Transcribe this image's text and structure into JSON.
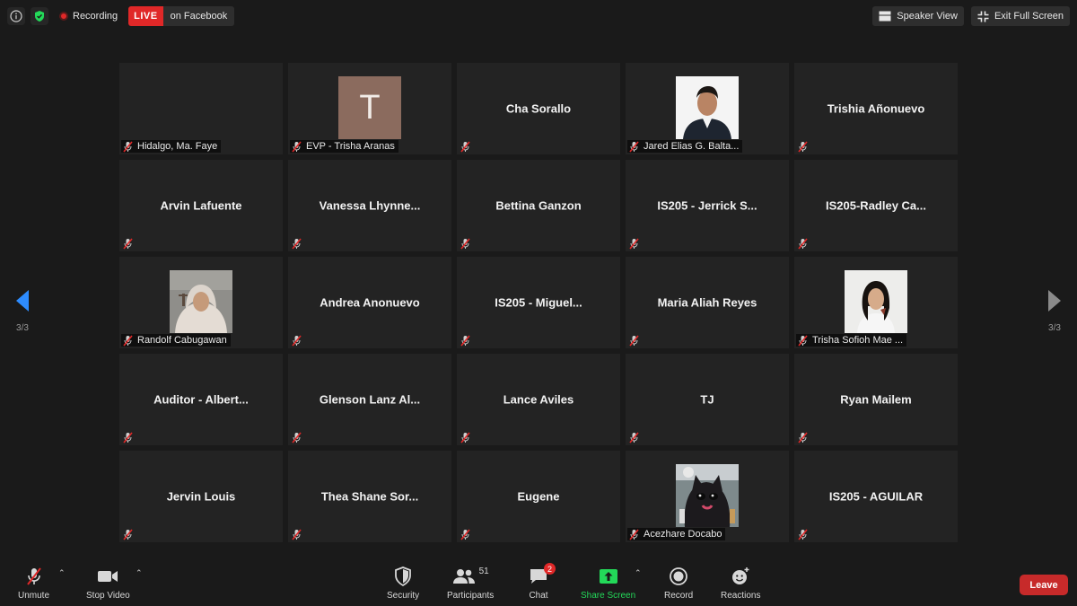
{
  "topbar": {
    "recording_label": "Recording",
    "live_label": "LIVE",
    "live_platform": "on Facebook",
    "speaker_view_label": "Speaker View",
    "exit_fullscreen_label": "Exit Full Screen"
  },
  "nav": {
    "left_page": "3/3",
    "right_page": "3/3"
  },
  "tiles": [
    {
      "display": "",
      "label": "Hidalgo, Ma. Faye",
      "avatar": "none"
    },
    {
      "display": "",
      "label": "EVP - Trisha Aranas",
      "avatar": "letter",
      "letter": "T"
    },
    {
      "display": "Cha Sorallo",
      "label": "",
      "avatar": "none"
    },
    {
      "display": "",
      "label": "Jared Elias G. Balta...",
      "avatar": "photo-man-suit"
    },
    {
      "display": "Trishia Añonuevo",
      "label": "",
      "avatar": "none"
    },
    {
      "display": "Arvin Lafuente",
      "label": "",
      "avatar": "none"
    },
    {
      "display": "Vanessa  Lhynne...",
      "label": "",
      "avatar": "none"
    },
    {
      "display": "Bettina Ganzon",
      "label": "",
      "avatar": "none"
    },
    {
      "display": "IS205  -  Jerrick S...",
      "label": "",
      "avatar": "none"
    },
    {
      "display": "IS205-Radley  Ca...",
      "label": "",
      "avatar": "none"
    },
    {
      "display": "",
      "label": "Randolf Cabugawan",
      "avatar": "photo-hoodie"
    },
    {
      "display": "Andrea Anonuevo",
      "label": "",
      "avatar": "none"
    },
    {
      "display": "IS205  -  Miguel...",
      "label": "",
      "avatar": "none"
    },
    {
      "display": "Maria Aliah Reyes",
      "label": "",
      "avatar": "none"
    },
    {
      "display": "",
      "label": "Trisha Sofioh Mae ...",
      "avatar": "photo-girl"
    },
    {
      "display": "Auditor  -  Albert...",
      "label": "",
      "avatar": "none"
    },
    {
      "display": "Glenson  Lanz  Al...",
      "label": "",
      "avatar": "none"
    },
    {
      "display": "Lance Aviles",
      "label": "",
      "avatar": "none"
    },
    {
      "display": "TJ",
      "label": "",
      "avatar": "none"
    },
    {
      "display": "Ryan Mailem",
      "label": "",
      "avatar": "none"
    },
    {
      "display": "Jervin Louis",
      "label": "",
      "avatar": "none"
    },
    {
      "display": "Thea  Shane  Sor...",
      "label": "",
      "avatar": "none"
    },
    {
      "display": "Eugene",
      "label": "",
      "avatar": "none"
    },
    {
      "display": "",
      "label": "Acezhare Docabo",
      "avatar": "photo-cat"
    },
    {
      "display": "IS205  -  AGUILAR",
      "label": "",
      "avatar": "none"
    }
  ],
  "toolbar": {
    "unmute": "Unmute",
    "stop_video": "Stop Video",
    "security": "Security",
    "participants": "Participants",
    "participants_count": "51",
    "chat": "Chat",
    "chat_badge": "2",
    "share_screen": "Share Screen",
    "record": "Record",
    "reactions": "Reactions",
    "leave": "Leave"
  },
  "colors": {
    "accent_red": "#e02828",
    "share_green": "#23d959",
    "nav_blue": "#2d8cff"
  }
}
